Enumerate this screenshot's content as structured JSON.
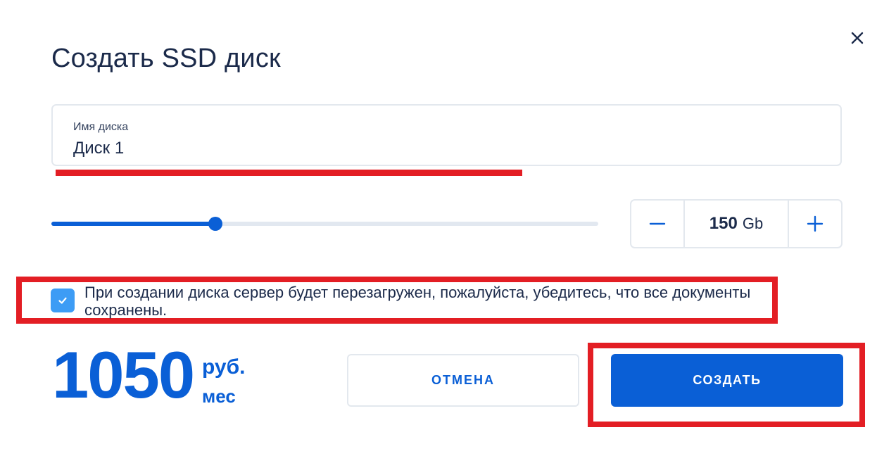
{
  "dialog": {
    "title": "Создать SSD диск",
    "close_icon": "close-icon"
  },
  "name_field": {
    "label": "Имя диска",
    "value": "Диск 1"
  },
  "size": {
    "slider_fraction": 0.3,
    "value": "150",
    "unit": "Gb",
    "decrement_icon": "minus-icon",
    "increment_icon": "plus-icon"
  },
  "warning": {
    "checked": true,
    "check_icon": "checkmark-icon",
    "text": "При создании диска сервер будет перезагружен, пожалуйста, убедитесь, что все документы сохранены."
  },
  "price": {
    "amount": "1050",
    "currency": "руб.",
    "period": "мес"
  },
  "actions": {
    "cancel_label": "ОТМЕНА",
    "create_label": "СОЗДАТЬ"
  },
  "colors": {
    "accent": "#0a5fd6",
    "checkbox": "#3d9cf5",
    "annotation": "#e31e24",
    "text": "#1b2a4a",
    "border": "#e3e8ee"
  }
}
